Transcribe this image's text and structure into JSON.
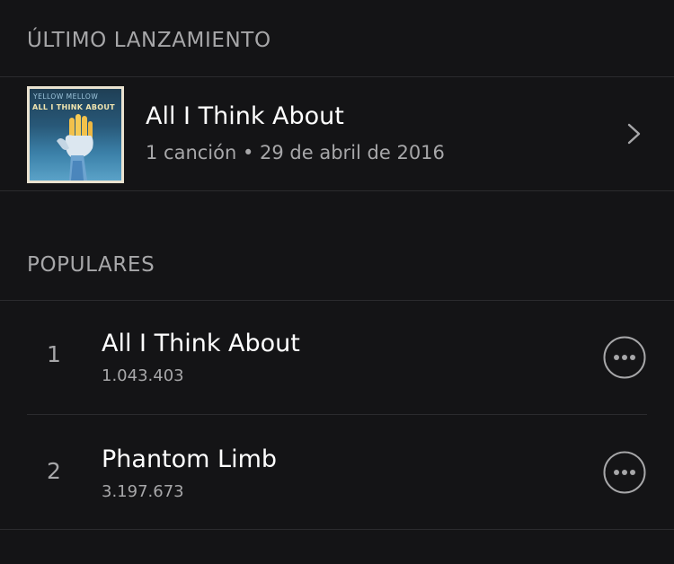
{
  "latest_release": {
    "header": "ÚLTIMO LANZAMIENTO",
    "album_art": {
      "band": "YELLOW MELLOW",
      "title": "ALL I THINK ABOUT"
    },
    "title": "All I Think About",
    "meta": "1 canción • 29 de abril de 2016"
  },
  "popular": {
    "header": "POPULARES",
    "tracks": [
      {
        "number": "1",
        "title": "All I Think About",
        "plays": "1.043.403"
      },
      {
        "number": "2",
        "title": "Phantom Limb",
        "plays": "3.197.673"
      }
    ]
  },
  "colors": {
    "background": "#141416",
    "secondary_text": "#a7a7a9",
    "divider": "#2b2b2e"
  },
  "icons": {
    "chevron": "chevron-right-icon",
    "more": "more-options-icon"
  }
}
